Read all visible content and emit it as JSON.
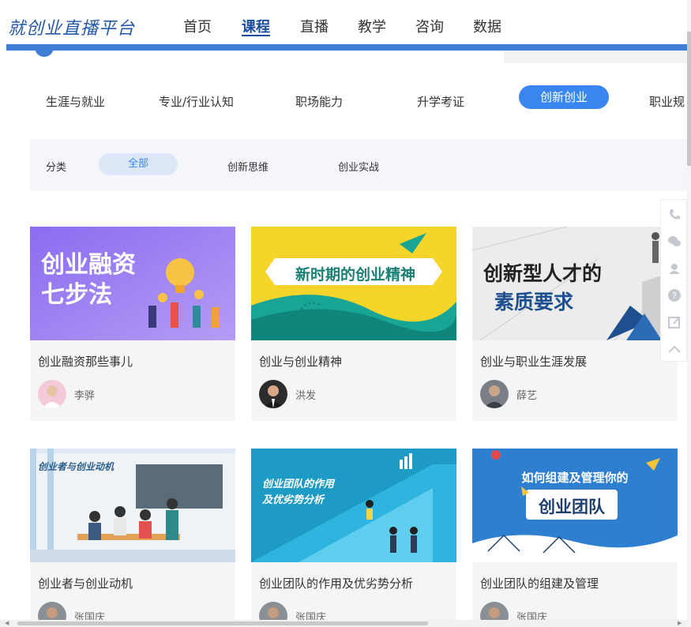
{
  "header": {
    "logo": "就创业直播平台",
    "nav": [
      "首页",
      "课程",
      "直播",
      "教学",
      "咨询",
      "数据"
    ],
    "active_nav": "课程"
  },
  "categories": [
    "生涯与就业",
    "专业/行业认知",
    "职场能力",
    "升学考证",
    "创新创业",
    "职业规"
  ],
  "active_category": "创新创业",
  "filter": {
    "label": "分类",
    "options": [
      "全部",
      "创新思维",
      "创业实战"
    ],
    "selected": "全部"
  },
  "courses": [
    {
      "title": "创业融资那些事儿",
      "author": "李骅",
      "thumb_text": [
        "创业融资",
        "七步法"
      ]
    },
    {
      "title": "创业与创业精神",
      "author": "洪发",
      "thumb_text": [
        "新时期的创业精神"
      ]
    },
    {
      "title": "创业与职业生涯发展",
      "author": "薛艺",
      "thumb_text": [
        "创新型人才的",
        "素质要求"
      ]
    },
    {
      "title": "创业者与创业动机",
      "author": "张国庆",
      "thumb_text": [
        "创业者与创业动机"
      ]
    },
    {
      "title": "创业团队的作用及优劣势分析",
      "author": "张国庆",
      "thumb_text": [
        "创业团队的作用",
        "及优劣势分析"
      ]
    },
    {
      "title": "创业团队的组建及管理",
      "author": "张国庆",
      "thumb_text": [
        "如何组建及管理你的",
        "创业团队"
      ]
    }
  ],
  "side_tools": [
    "phone-icon",
    "wechat-icon",
    "service-icon",
    "help-icon",
    "edit-icon",
    "back-to-top-icon"
  ],
  "colors": {
    "brand": "#2457a8",
    "accent": "#3a86f0",
    "header_bar": "#3f7fd7"
  }
}
